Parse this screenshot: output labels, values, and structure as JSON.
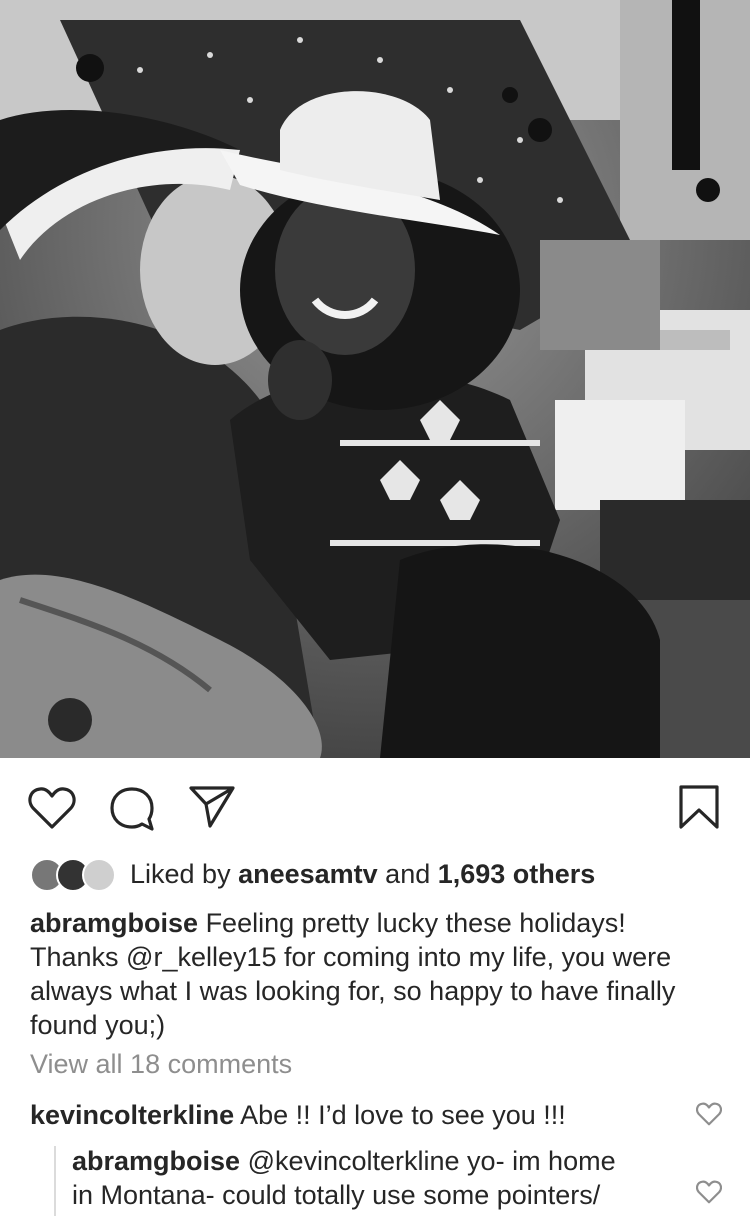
{
  "post": {
    "likes": {
      "prefix": "Liked by ",
      "user": "aneesamtv",
      "middle": " and ",
      "count": "1,693 others"
    },
    "caption": {
      "username": "abramgboise",
      "text": " Feeling pretty lucky these holidays!\nThanks @r_kelley15 for coming into my life, you were always what I was looking for, so happy to have finally found you;)"
    },
    "view_all_comments": "View all 18 comments",
    "comments": [
      {
        "username": "kevincolterkline",
        "text": " Abe !! I’d love to see you !!!"
      },
      {
        "username": "abramgboise",
        "text": " @kevincolterkline yo- im home\nin Montana- could totally use some pointers/"
      }
    ]
  },
  "icons": {
    "like": "heart-icon",
    "comment": "comment-bubble-icon",
    "share": "paper-plane-icon",
    "save": "bookmark-icon",
    "comment_like": "heart-icon"
  },
  "colors": {
    "text": "#262626",
    "muted": "#8e8e8e",
    "divider": "#dbdbdb"
  }
}
